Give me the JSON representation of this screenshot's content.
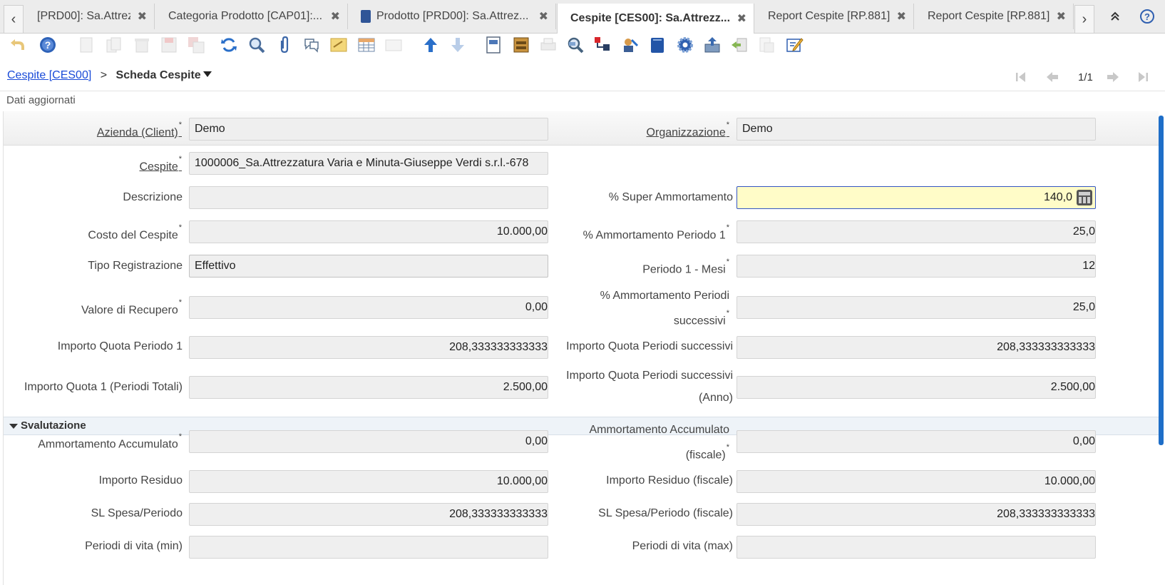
{
  "tabs": [
    {
      "label": "[PRD00]: Sa.Attrez...",
      "active": false
    },
    {
      "label": "Categoria Prodotto [CAP01]:...",
      "active": false
    },
    {
      "label": "Prodotto [PRD00]: Sa.Attrez...",
      "active": false
    },
    {
      "label": "Cespite [CES00]: Sa.Attrezz...",
      "active": true
    },
    {
      "label": "Report Cespite [RP.881]",
      "active": false
    },
    {
      "label": "Report Cespite [RP.881]",
      "active": false
    }
  ],
  "tab_controls": {
    "prev": "‹",
    "next": "›",
    "close": "✖",
    "collapse": "⌃",
    "help": "?"
  },
  "breadcrumb": {
    "link": "Cespite [CES00]",
    "separator": ">",
    "current": "Scheda Cespite"
  },
  "record_nav": {
    "count": "1/1"
  },
  "status": "Dati aggiornati",
  "required_mark": "*",
  "form": {
    "client_label": "Azienda (Client)",
    "client_value": "Demo",
    "org_label": "Organizzazione",
    "org_value": "Demo",
    "asset_label": "Cespite",
    "asset_value": "1000006_Sa.Attrezzatura Varia e Minuta-Giuseppe Verdi s.r.l.-678",
    "descr_label": "Descrizione",
    "descr_value": "",
    "super_label": "% Super Ammortamento",
    "super_value": "140,0",
    "cost_label": "Costo del Cespite",
    "cost_value": "10.000,00",
    "amm1_label": "% Ammortamento Periodo 1",
    "amm1_value": "25,0",
    "reg_label": "Tipo Registrazione",
    "reg_value": "Effettivo",
    "mesi_label": "Periodo 1 - Mesi",
    "mesi_value": "12",
    "recup_label": "Valore di Recupero",
    "recup_value": "0,00",
    "ammsucc_label1": "% Ammortamento Periodi",
    "ammsucc_label2": "successivi",
    "ammsucc_value": "25,0",
    "quota1_label": "Importo Quota Periodo 1",
    "quota1_value": "208,333333333333",
    "quotasucc_label": "Importo Quota Periodi successivi",
    "quotasucc_value": "208,333333333333",
    "quota1tot_label": "Importo Quota 1 (Periodi Totali)",
    "quota1tot_value": "2.500,00",
    "quotaanno_label1": "Importo Quota Periodi successivi",
    "quotaanno_label2": "(Anno)",
    "quotaanno_value": "2.500,00"
  },
  "section": {
    "title": "Svalutazione",
    "accum_label": "Ammortamento Accumulato",
    "accum_value": "0,00",
    "accumf_label1": "Ammortamento Accumulato",
    "accumf_label2": "(fiscale)",
    "accumf_value": "0,00",
    "resid_label": "Importo Residuo",
    "resid_value": "10.000,00",
    "residf_label": "Importo Residuo (fiscale)",
    "residf_value": "10.000,00",
    "sl_label": "SL Spesa/Periodo",
    "sl_value": "208,333333333333",
    "slf_label": "SL Spesa/Periodo (fiscale)",
    "slf_value": "208,333333333333",
    "vmin_label": "Periodi di vita (min)",
    "vmin_value": "",
    "vmax_label": "Periodi di vita (max)",
    "vmax_value": ""
  }
}
